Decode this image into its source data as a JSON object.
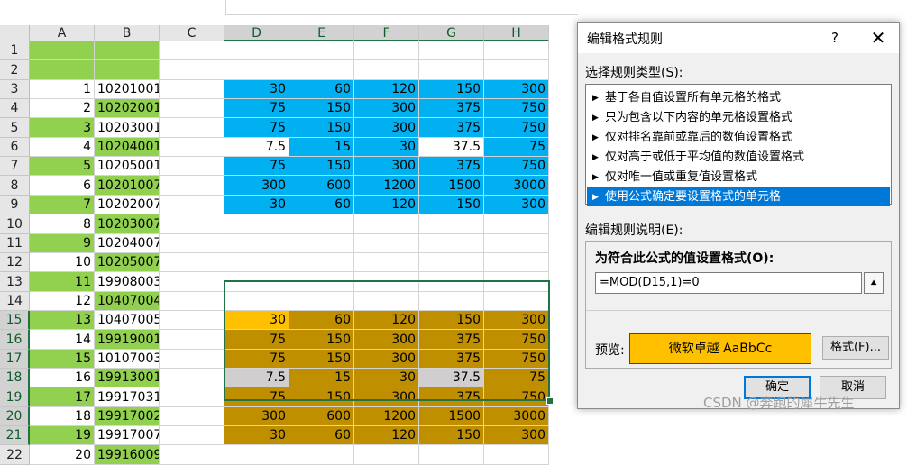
{
  "columns": [
    "A",
    "B",
    "C",
    "D",
    "E",
    "F",
    "G",
    "H"
  ],
  "rows": [
    {
      "n": "1",
      "a": "",
      "b": ""
    },
    {
      "n": "2",
      "a": "",
      "b": ""
    },
    {
      "n": "3",
      "a": "1",
      "b": "10201001",
      "d": [
        "30",
        "60",
        "120",
        "150",
        "300"
      ]
    },
    {
      "n": "4",
      "a": "2",
      "b": "10202001",
      "d": [
        "75",
        "150",
        "300",
        "375",
        "750"
      ]
    },
    {
      "n": "5",
      "a": "3",
      "b": "10203001",
      "d": [
        "75",
        "150",
        "300",
        "375",
        "750"
      ]
    },
    {
      "n": "6",
      "a": "4",
      "b": "10204001",
      "d": [
        "7.5",
        "15",
        "30",
        "37.5",
        "75"
      ]
    },
    {
      "n": "7",
      "a": "5",
      "b": "10205001",
      "d": [
        "75",
        "150",
        "300",
        "375",
        "750"
      ]
    },
    {
      "n": "8",
      "a": "6",
      "b": "10201007",
      "d": [
        "300",
        "600",
        "1200",
        "1500",
        "3000"
      ]
    },
    {
      "n": "9",
      "a": "7",
      "b": "10202007",
      "d": [
        "30",
        "60",
        "120",
        "150",
        "300"
      ]
    },
    {
      "n": "10",
      "a": "8",
      "b": "10203007"
    },
    {
      "n": "11",
      "a": "9",
      "b": "10204007"
    },
    {
      "n": "12",
      "a": "10",
      "b": "10205007"
    },
    {
      "n": "13",
      "a": "11",
      "b": "19908003"
    },
    {
      "n": "14",
      "a": "12",
      "b": "10407004"
    },
    {
      "n": "15",
      "a": "13",
      "b": "10407005",
      "d": [
        "30",
        "60",
        "120",
        "150",
        "300"
      ]
    },
    {
      "n": "16",
      "a": "14",
      "b": "19919001",
      "d": [
        "75",
        "150",
        "300",
        "375",
        "750"
      ]
    },
    {
      "n": "17",
      "a": "15",
      "b": "10107003",
      "d": [
        "75",
        "150",
        "300",
        "375",
        "750"
      ]
    },
    {
      "n": "18",
      "a": "16",
      "b": "19913001",
      "d": [
        "7.5",
        "15",
        "30",
        "37.5",
        "75"
      ]
    },
    {
      "n": "19",
      "a": "17",
      "b": "19917031",
      "d": [
        "75",
        "150",
        "300",
        "375",
        "750"
      ]
    },
    {
      "n": "20",
      "a": "18",
      "b": "19917002",
      "d": [
        "300",
        "600",
        "1200",
        "1500",
        "3000"
      ]
    },
    {
      "n": "21",
      "a": "19",
      "b": "19917007",
      "d": [
        "30",
        "60",
        "120",
        "150",
        "300"
      ]
    },
    {
      "n": "22",
      "a": "20",
      "b": "19916009"
    }
  ],
  "colors": {
    "green": "#92d050",
    "blue": "#00b0f0",
    "gold": "#bf8f00",
    "lightGold": "#ffc000",
    "grey": "#d0cece",
    "white": "#ffffff"
  },
  "dialog": {
    "title": "编辑格式规则",
    "help": "?",
    "close": "✕",
    "select_type_label": "选择规则类型(S):",
    "rule_types": [
      "基于各自值设置所有单元格的格式",
      "只为包含以下内容的单元格设置格式",
      "仅对排名靠前或靠后的数值设置格式",
      "仅对高于或低于平均值的数值设置格式",
      "仅对唯一值或重复值设置格式",
      "使用公式确定要设置格式的单元格"
    ],
    "selected_rule_index": 5,
    "edit_desc_label": "编辑规则说明(E):",
    "formula_label": "为符合此公式的值设置格式(O):",
    "formula_value": "=MOD(D15,1)=0",
    "ref_icon": "⯅",
    "preview_label": "预览:",
    "preview_text": "微软卓越  AaBbCc",
    "format_button": "格式(F)...",
    "ok_button": "确定",
    "cancel_button": "取消"
  },
  "watermark": "CSDN @奔跑的犀牛先生"
}
